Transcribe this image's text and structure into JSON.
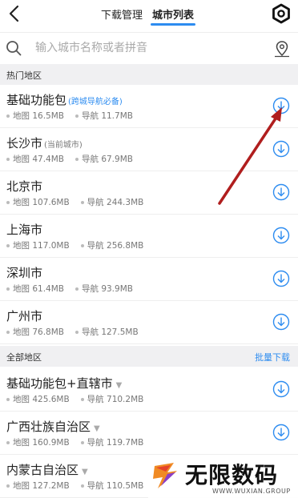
{
  "header": {
    "tabs": [
      {
        "label": "下载管理",
        "active": false
      },
      {
        "label": "城市列表",
        "active": true
      }
    ],
    "accent": "#2d8cf0"
  },
  "search": {
    "placeholder": "输入城市名称或者拼音"
  },
  "hot_section": {
    "title": "热门地区",
    "items": [
      {
        "name": "基础功能包",
        "note": "(跨城导航必备)",
        "map": "地图 16.5MB",
        "nav": "导航 11.7MB"
      },
      {
        "name": "长沙市",
        "note": "(当前城市)",
        "map": "地图 47.4MB",
        "nav": "导航 67.9MB"
      },
      {
        "name": "北京市",
        "map": "地图 107.6MB",
        "nav": "导航 244.3MB"
      },
      {
        "name": "上海市",
        "map": "地图 117.0MB",
        "nav": "导航 256.8MB"
      },
      {
        "name": "深圳市",
        "map": "地图 61.4MB",
        "nav": "导航 93.9MB"
      },
      {
        "name": "广州市",
        "map": "地图 76.8MB",
        "nav": "导航 127.5MB"
      }
    ]
  },
  "all_section": {
    "title": "全部地区",
    "action": "批量下载",
    "items": [
      {
        "name": "基础功能包+直辖市",
        "map": "地图 425.6MB",
        "nav": "导航 710.2MB"
      },
      {
        "name": "广西壮族自治区",
        "map": "地图 160.9MB",
        "nav": "导航 119.7MB"
      },
      {
        "name": "内蒙古自治区",
        "map": "地图 127.2MB",
        "nav": "导航 110.5MB"
      }
    ]
  },
  "watermark": {
    "text": "无限数码",
    "url": "WWW.WUXIAN.GROUP"
  },
  "icons": [
    "back-arrow-icon",
    "settings-gear-icon",
    "search-icon",
    "location-pin-icon",
    "download-icon",
    "dropdown-triangle-icon"
  ]
}
